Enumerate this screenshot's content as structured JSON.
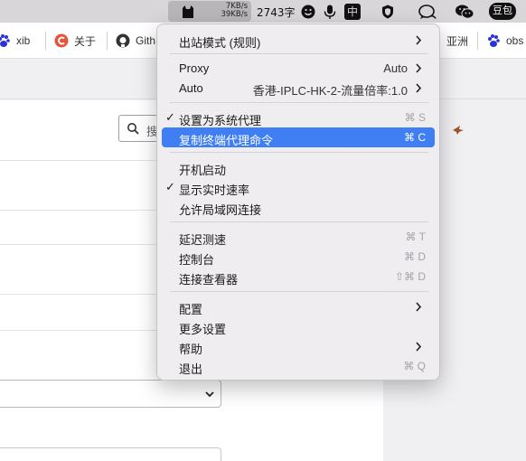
{
  "menubar": {
    "speed_up": "7KB/s",
    "speed_down": "39KB/s",
    "word_count": "2743字",
    "input_method": "中",
    "douban": "豆包",
    "icons": [
      "clashx-cat-icon",
      "smile-face-icon",
      "microphone-icon",
      "input-method-icon",
      "shield-icon",
      "chat-bubble-icon",
      "wechat-icon",
      "douban-icon"
    ]
  },
  "bookmarks": {
    "items": [
      {
        "label": "xib",
        "icon": "baidu-paw-icon",
        "color": "#2932e1"
      },
      {
        "label": "关于",
        "icon": "c-circle-icon",
        "color": "#e5533b"
      },
      {
        "label": "Gith",
        "icon": "github-icon",
        "color": "#333333"
      },
      {
        "label": "亚洲",
        "icon": "",
        "color": ""
      },
      {
        "label": "obs",
        "icon": "baidu-paw-icon",
        "color": "#2932e1"
      }
    ]
  },
  "search": {
    "placeholder": "搜"
  },
  "menu": {
    "outbound_mode": "出站模式 (规则)",
    "proxy": {
      "label": "Proxy",
      "value": "Auto"
    },
    "auto": {
      "label": "Auto",
      "value": "香港-IPLC-HK-2-流量倍率:1.0"
    },
    "set_system_proxy": {
      "label": "设置为系统代理",
      "shortcut": "⌘ S",
      "checked": "✓"
    },
    "copy_terminal": {
      "label": "复制终端代理命令",
      "shortcut": "⌘ C"
    },
    "start_at_login": "开机启动",
    "show_speed": {
      "label": "显示实时速率",
      "checked": "✓"
    },
    "allow_lan": "允许局域网连接",
    "latency_test": {
      "label": "延迟测速",
      "shortcut": "⌘ T"
    },
    "dashboard": {
      "label": "控制台",
      "shortcut": "⌘ D"
    },
    "connections": {
      "label": "连接查看器",
      "shortcut": "⇧⌘ D"
    },
    "config": "配置",
    "more_settings": "更多设置",
    "help": "帮助",
    "quit": {
      "label": "退出",
      "shortcut": "⌘ Q"
    }
  },
  "colors": {
    "highlight": "#3f7ff3",
    "menubar": "#d9d6da"
  }
}
